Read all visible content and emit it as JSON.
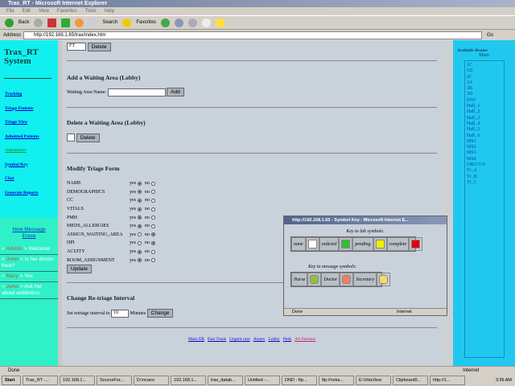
{
  "window": {
    "title": "Trax_RT - Microsoft Internet Explorer",
    "menu": [
      "File",
      "Edit",
      "View",
      "Favorites",
      "Tools",
      "Help"
    ],
    "toolbar": {
      "back": "Back",
      "search": "Search",
      "favorites": "Favorites"
    },
    "address_label": "Address",
    "address": "http://192.168.1.65/trax/index.htm",
    "go": "Go",
    "status": "Done",
    "zone": "Internet"
  },
  "left": {
    "title": "Trax_RT System",
    "nav": [
      "Tracking",
      "Triage Patients",
      "Triage View",
      "Admitted Patients",
      "Administer",
      "Symbol Key",
      "Chat",
      "Generate Reports"
    ],
    "chat_links": [
      "New Message",
      "Erase"
    ],
    "messages": [
      {
        "user": "Admin",
        "text": "Welcome"
      },
      {
        "user": "John",
        "text": "Is her doctor here?"
      },
      {
        "user": "Mary",
        "text": "Yes"
      },
      {
        "user": "John",
        "text": "Ask her about antibiotics."
      }
    ]
  },
  "main": {
    "top_select": "FT",
    "delete_label": "Delete",
    "add_title": "Add a Waiting Area (Lobby)",
    "waiting_area_label": "Waiting Area Name:",
    "waiting_area_value": "",
    "add_label": "Add",
    "delete_title": "Delete a Waiting Area (Lobby)",
    "modify_title": "Modify Triage Form",
    "yes": "yes",
    "no": "no",
    "fields": [
      {
        "name": "NAME",
        "yes": true
      },
      {
        "name": "DEMOGRAPHICS",
        "yes": true
      },
      {
        "name": "CC",
        "yes": true
      },
      {
        "name": "VITALS",
        "yes": true
      },
      {
        "name": "PMH",
        "yes": true
      },
      {
        "name": "MEDS_ALLERGIES",
        "yes": true
      },
      {
        "name": "ASSIGN_WAITING_AREA",
        "yes": false
      },
      {
        "name": "HPI",
        "yes": false
      },
      {
        "name": "ACUITY",
        "yes": true
      },
      {
        "name": "ROOM_ASSIGNMENT",
        "yes": true
      }
    ],
    "update_label": "Update",
    "retriage_title": "Change Re-triage Interval",
    "retriage_label": "Set retriage interval to",
    "retriage_value": "10",
    "minutes": "Minutes",
    "change_label": "Change",
    "footer_links": [
      "Main ER",
      "Fast Track",
      "Urgent care",
      "Annex",
      "Lobby",
      "Peds",
      "All Patients"
    ]
  },
  "right": {
    "title": "Available Rooms",
    "subtitle": "Main",
    "rooms": [
      "1C",
      "1D",
      "2C",
      "3A",
      "3B",
      "3D",
      "ENT",
      "Hall_1",
      "Hall_2",
      "Hall_3",
      "Hall_4",
      "Hall_5",
      "Hall_6",
      "MS1",
      "MS2",
      "MS3",
      "MS4",
      "OB/GYN",
      "Tr_A",
      "Tr_B",
      "Tr_C"
    ]
  },
  "popup": {
    "title": "http://192.168.1.65 - Symbol Key - Microsoft Internet E...",
    "lab_title": "Key to lab symbols:",
    "lab": [
      {
        "label": "none",
        "color": "#ffffff"
      },
      {
        "label": "ordered",
        "color": "#30c030"
      },
      {
        "label": "pending",
        "color": "#f0f000"
      },
      {
        "label": "complete",
        "color": "#e00010"
      }
    ],
    "msg_title": "Key to message symbols:",
    "msg": [
      {
        "label": "Nurse",
        "color": "#90c040"
      },
      {
        "label": "Doctor",
        "color": "#f08060"
      },
      {
        "label": "Secretary",
        "color": "#f0e060"
      }
    ],
    "status": "Done",
    "zone": "Internet"
  },
  "taskbar": {
    "start": "Start",
    "items": [
      "Trax_RT -...",
      "192.168.1...",
      "SourceFor...",
      "D:\\ncano",
      "192.168.1...",
      "trax_datab...",
      "Untitled -...",
      "DND - ftp...",
      "ftp://ncka...",
      "E:\\VitaView",
      "Clipboard0...",
      "http://1..."
    ],
    "clock": "3:36 AM"
  }
}
